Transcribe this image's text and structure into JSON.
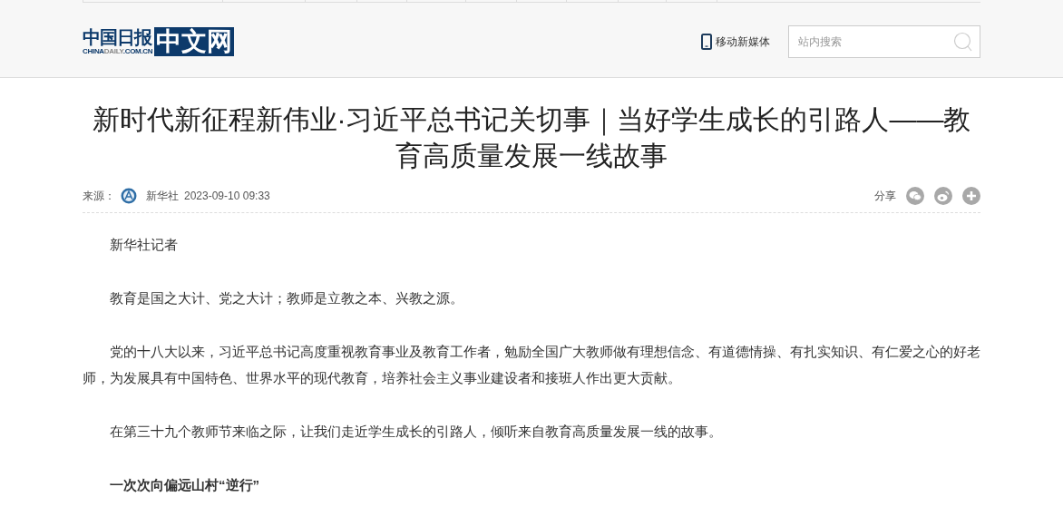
{
  "header": {
    "logo": {
      "brand": "中国日报",
      "domain_part1": "CHINA",
      "domain_part2": "DAILY",
      "domain_part3": ".COM.CN",
      "badge": "中文网"
    },
    "mobile_link": "移动新媒体",
    "search": {
      "placeholder": "站内搜索"
    }
  },
  "article": {
    "title": "新时代新征程新伟业·习近平总书记关切事｜当好学生成长的引路人——教育高质量发展一线故事",
    "meta": {
      "source_label": "来源：",
      "source": "新华社",
      "date": "2023-09-10 09:33"
    },
    "share": {
      "label": "分享",
      "icons": [
        {
          "kind": "wechat"
        },
        {
          "kind": "weibo"
        },
        {
          "kind": "more"
        }
      ]
    },
    "paragraphs": [
      {
        "kind": "text",
        "text": "新华社记者"
      },
      {
        "kind": "text",
        "text": "教育是国之大计、党之大计；教师是立教之本、兴教之源。"
      },
      {
        "kind": "text",
        "text": "党的十八大以来，习近平总书记高度重视教育事业及教育工作者，勉励全国广大教师做有理想信念、有道德情操、有扎实知识、有仁爱之心的好老师，为发展具有中国特色、世界水平的现代教育，培养社会主义事业建设者和接班人作出更大贡献。"
      },
      {
        "kind": "text",
        "text": "在第三十九个教师节来临之际，让我们走近学生成长的引路人，倾听来自教育高质量发展一线的故事。"
      },
      {
        "kind": "heading",
        "text": "一次次向偏远山村“逆行”"
      }
    ]
  }
}
